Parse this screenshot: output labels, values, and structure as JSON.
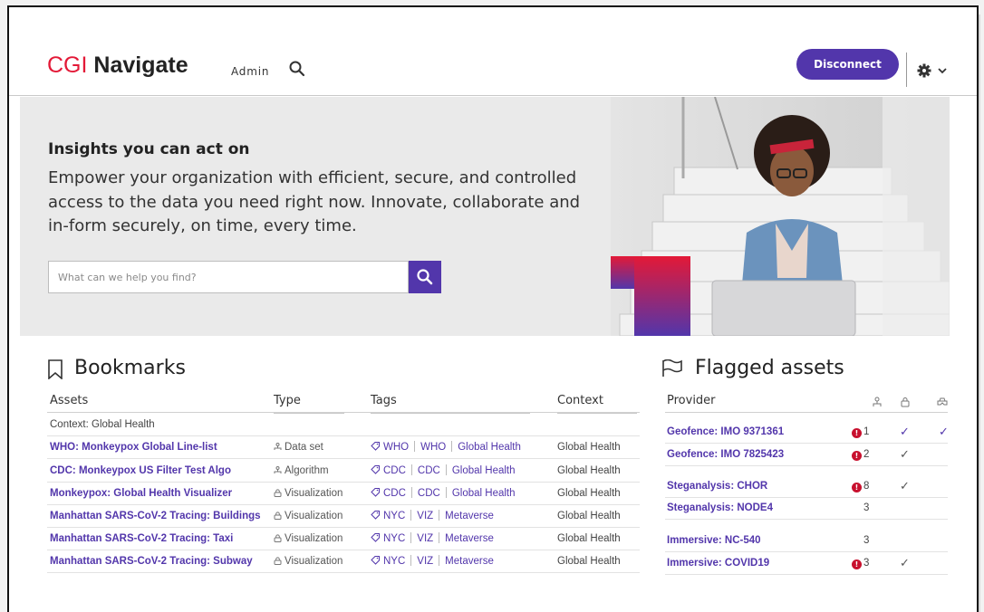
{
  "header": {
    "logo_cgi": "CGI",
    "logo_navigate": "Navigate",
    "admin_label": "Admin",
    "disconnect_label": "Disconnect"
  },
  "hero": {
    "title": "Insights you can act on",
    "text": "Empower your organization with efficient, secure, and controlled access to the data you need right now. Innovate, collaborate and in-form securely, on time, every time.",
    "search_placeholder": "What can we help you find?"
  },
  "bookmarks": {
    "title": "Bookmarks",
    "columns": {
      "assets": "Assets",
      "type": "Type",
      "tags": "Tags",
      "context": "Context"
    },
    "filter_context": "Context: Global Health",
    "rows": [
      {
        "asset": "WHO: Monkeypox Global Line-list",
        "type": "Data set",
        "type_icon": "dataset-icon",
        "tags": [
          "WHO",
          "WHO",
          "Global Health"
        ],
        "context": "Global Health"
      },
      {
        "asset": "CDC: Monkeypox US Filter Test Algo",
        "type": "Algorithm",
        "type_icon": "algorithm-icon",
        "tags": [
          "CDC",
          "CDC",
          "Global Health"
        ],
        "context": "Global Health"
      },
      {
        "asset": "Monkeypox: Global Health Visualizer",
        "type": "Visualization",
        "type_icon": "visualization-icon",
        "tags": [
          "CDC",
          "CDC",
          "Global Health"
        ],
        "context": "Global Health"
      },
      {
        "asset": "Manhattan SARS-CoV-2 Tracing: Buildings",
        "type": "Visualization",
        "type_icon": "visualization-icon",
        "tags": [
          "NYC",
          "VIZ",
          "Metaverse"
        ],
        "context": "Global Health"
      },
      {
        "asset": "Manhattan SARS-CoV-2 Tracing: Taxi",
        "type": "Visualization",
        "type_icon": "visualization-icon",
        "tags": [
          "NYC",
          "VIZ",
          "Metaverse"
        ],
        "context": "Global Health"
      },
      {
        "asset": "Manhattan SARS-CoV-2 Tracing: Subway",
        "type": "Visualization",
        "type_icon": "visualization-icon",
        "tags": [
          "NYC",
          "VIZ",
          "Metaverse"
        ],
        "context": "Global Health"
      }
    ]
  },
  "flagged": {
    "title": "Flagged assets",
    "column_provider": "Provider",
    "rows": [
      {
        "provider": "Geofence: IMO 9371361",
        "alert": true,
        "count": "1",
        "check1": "✓",
        "check2": "✓"
      },
      {
        "provider": "Geofence: IMO 7825423",
        "alert": true,
        "count": "2",
        "check1": "✓",
        "check2": ""
      },
      {
        "provider": "Steganalysis: CHOR",
        "alert": true,
        "count": "8",
        "check1": "✓",
        "check2": ""
      },
      {
        "provider": "Steganalysis: NODE4",
        "alert": false,
        "count": "3",
        "check1": "",
        "check2": ""
      },
      {
        "provider": "Immersive: NC-540",
        "alert": false,
        "count": "3",
        "check1": "",
        "check2": ""
      },
      {
        "provider": "Immersive: COVID19",
        "alert": true,
        "count": "3",
        "check1": "✓",
        "check2": ""
      }
    ]
  },
  "colors": {
    "accent": "#5236ab",
    "brand_red": "#e31937",
    "alert": "#c8102e"
  }
}
